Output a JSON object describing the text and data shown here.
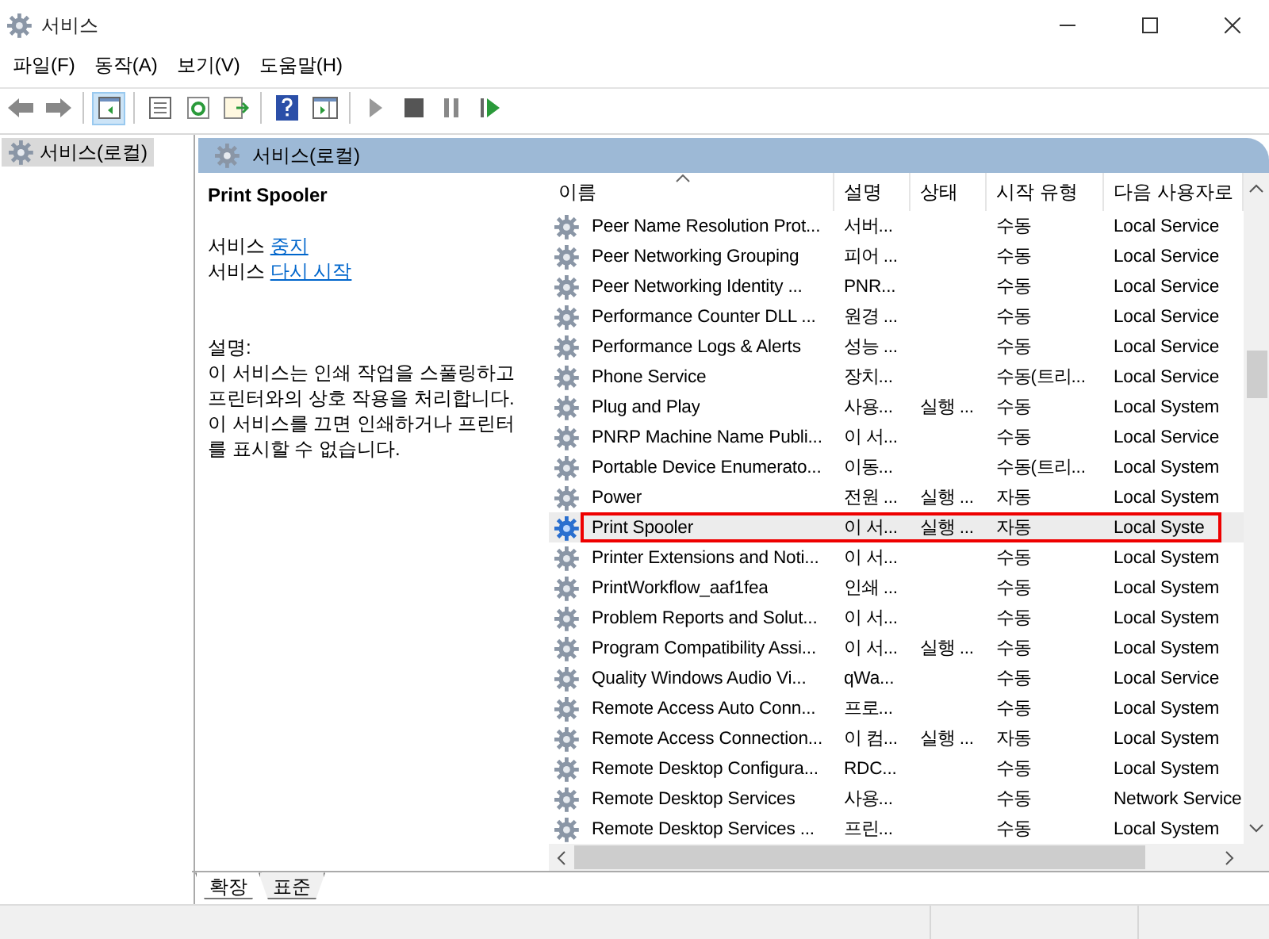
{
  "window": {
    "title": "서비스"
  },
  "menu": [
    "파일(F)",
    "동작(A)",
    "보기(V)",
    "도움말(H)"
  ],
  "toolbar": {
    "console_tree_pressed": true
  },
  "tree": {
    "items": [
      {
        "label": "서비스(로컬)",
        "selected": true
      }
    ]
  },
  "pane_header": "서비스(로컬)",
  "details": {
    "title": "Print Spooler",
    "actions": [
      {
        "prefix": "서비스",
        "link": "중지"
      },
      {
        "prefix": "서비스",
        "link": "다시 시작"
      }
    ],
    "description_label": "설명:",
    "description": "이 서비스는 인쇄 작업을 스풀링하고 프린터와의 상호 작용을 처리합니다. 이 서비스를 끄면 인쇄하거나 프린터를 표시할 수 없습니다."
  },
  "table": {
    "columns": [
      "이름",
      "설명",
      "상태",
      "시작 유형",
      "다음 사용자로"
    ],
    "rows": [
      {
        "name": "Peer Name Resolution Prot...",
        "desc": "서버...",
        "status": "",
        "startup": "수동",
        "logon": "Local Service",
        "selected": false
      },
      {
        "name": "Peer Networking Grouping",
        "desc": "피어 ...",
        "status": "",
        "startup": "수동",
        "logon": "Local Service",
        "selected": false
      },
      {
        "name": "Peer Networking Identity ...",
        "desc": "PNR...",
        "status": "",
        "startup": "수동",
        "logon": "Local Service",
        "selected": false
      },
      {
        "name": "Performance Counter DLL ...",
        "desc": "원경 ...",
        "status": "",
        "startup": "수동",
        "logon": "Local Service",
        "selected": false
      },
      {
        "name": "Performance Logs & Alerts",
        "desc": "성능 ...",
        "status": "",
        "startup": "수동",
        "logon": "Local Service",
        "selected": false
      },
      {
        "name": "Phone Service",
        "desc": "장치...",
        "status": "",
        "startup": "수동(트리...",
        "logon": "Local Service",
        "selected": false
      },
      {
        "name": "Plug and Play",
        "desc": "사용...",
        "status": "실행 ...",
        "startup": "수동",
        "logon": "Local System",
        "selected": false
      },
      {
        "name": "PNRP Machine Name Publi...",
        "desc": "이 서...",
        "status": "",
        "startup": "수동",
        "logon": "Local Service",
        "selected": false
      },
      {
        "name": "Portable Device Enumerato...",
        "desc": "이동...",
        "status": "",
        "startup": "수동(트리...",
        "logon": "Local System",
        "selected": false
      },
      {
        "name": "Power",
        "desc": "전원 ...",
        "status": "실행 ...",
        "startup": "자동",
        "logon": "Local System",
        "selected": false
      },
      {
        "name": "Print Spooler",
        "desc": "이 서...",
        "status": "실행 ...",
        "startup": "자동",
        "logon": "Local Syste",
        "selected": true
      },
      {
        "name": "Printer Extensions and Noti...",
        "desc": "이 서...",
        "status": "",
        "startup": "수동",
        "logon": "Local System",
        "selected": false
      },
      {
        "name": "PrintWorkflow_aaf1fea",
        "desc": "인쇄 ...",
        "status": "",
        "startup": "수동",
        "logon": "Local System",
        "selected": false
      },
      {
        "name": "Problem Reports and Solut...",
        "desc": "이 서...",
        "status": "",
        "startup": "수동",
        "logon": "Local System",
        "selected": false
      },
      {
        "name": "Program Compatibility Assi...",
        "desc": "이 서...",
        "status": "실행 ...",
        "startup": "수동",
        "logon": "Local System",
        "selected": false
      },
      {
        "name": "Quality Windows Audio Vi...",
        "desc": "qWa...",
        "status": "",
        "startup": "수동",
        "logon": "Local Service",
        "selected": false
      },
      {
        "name": "Remote Access Auto Conn...",
        "desc": "프로...",
        "status": "",
        "startup": "수동",
        "logon": "Local System",
        "selected": false
      },
      {
        "name": "Remote Access Connection...",
        "desc": "이 컴...",
        "status": "실행 ...",
        "startup": "자동",
        "logon": "Local System",
        "selected": false
      },
      {
        "name": "Remote Desktop Configura...",
        "desc": "RDC...",
        "status": "",
        "startup": "수동",
        "logon": "Local System",
        "selected": false
      },
      {
        "name": "Remote Desktop Services",
        "desc": "사용...",
        "status": "",
        "startup": "수동",
        "logon": "Network Service",
        "selected": false
      },
      {
        "name": "Remote Desktop Services ...",
        "desc": "프린...",
        "status": "",
        "startup": "수동",
        "logon": "Local System",
        "selected": false
      }
    ]
  },
  "view_tabs": [
    {
      "label": "확장",
      "selected": true
    },
    {
      "label": "표준",
      "selected": false
    }
  ]
}
